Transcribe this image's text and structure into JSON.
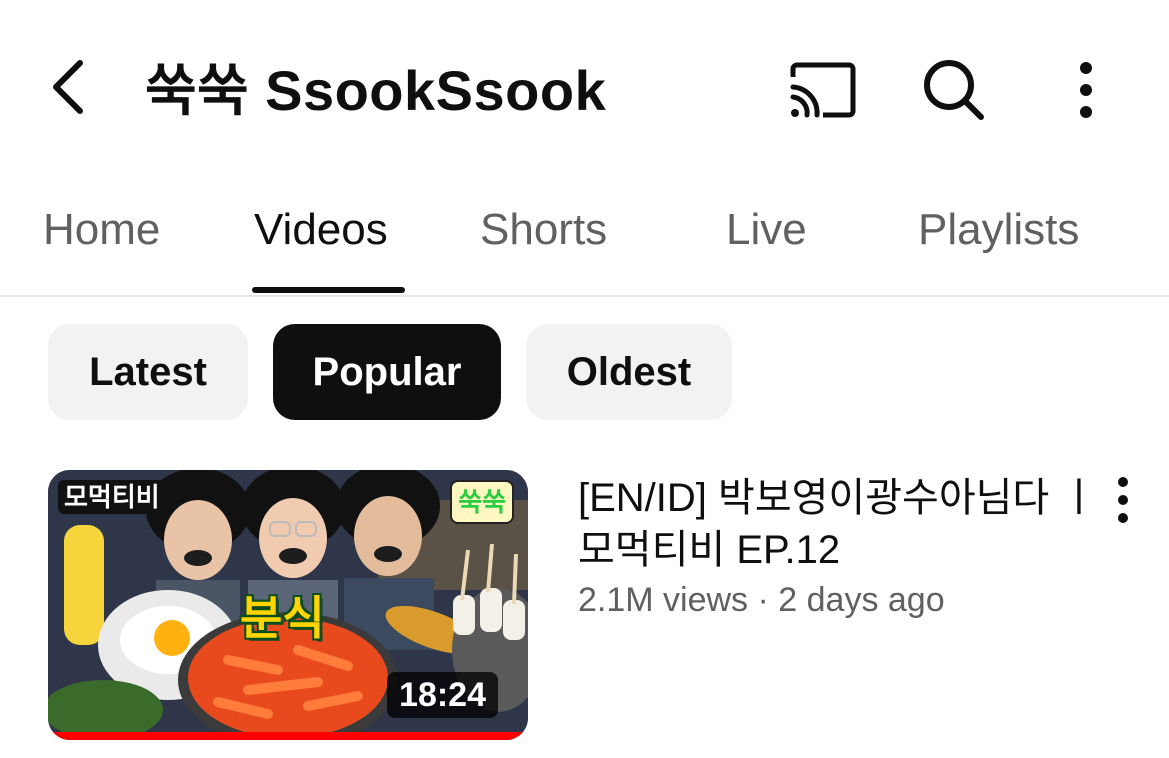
{
  "header": {
    "channel_title": "쑥쑥 SsookSsook",
    "icons": {
      "back": "back-arrow-icon",
      "cast": "cast-icon",
      "search": "search-icon",
      "more": "more-vert-icon"
    }
  },
  "tabs": [
    {
      "label": "Home",
      "active": false
    },
    {
      "label": "Videos",
      "active": true
    },
    {
      "label": "Shorts",
      "active": false
    },
    {
      "label": "Live",
      "active": false
    },
    {
      "label": "Playlists",
      "active": false
    }
  ],
  "filters": [
    {
      "label": "Latest",
      "selected": false
    },
    {
      "label": "Popular",
      "selected": true
    },
    {
      "label": "Oldest",
      "selected": false
    }
  ],
  "videos": [
    {
      "title": "[EN/ID] 박보영이광수아님다 ㅣ 모먹티비 EP.12",
      "meta": "2.1M views · 2 days ago",
      "duration": "18:24",
      "thumbnail": {
        "badge_left": "모먹티비",
        "badge_right": "쑥쑥",
        "caption": "분식"
      },
      "watch_progress": 1.0
    }
  ],
  "colors": {
    "accent": "#ff0000",
    "text_primary": "#0f0f0f",
    "text_secondary": "#606060",
    "chip_bg": "#f2f2f2"
  }
}
